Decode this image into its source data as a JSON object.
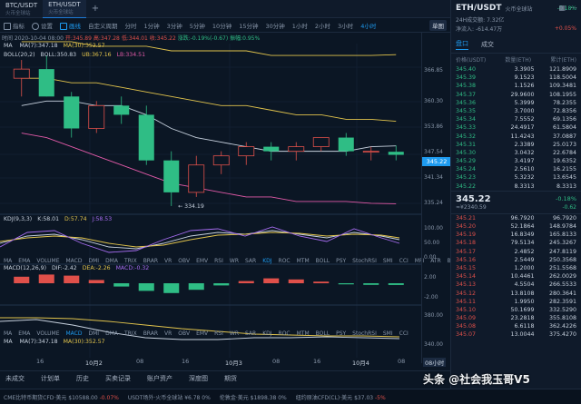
{
  "tabs": [
    {
      "pair": "BTC/USDT",
      "exchange": "火币全球站"
    },
    {
      "pair": "ETH/USDT",
      "exchange": "火币全球站"
    }
  ],
  "toolbar": {
    "items": [
      "指标",
      "设置",
      "画线",
      "自定义周期",
      "分时",
      "1分钟",
      "3分钟",
      "5分钟",
      "10分钟",
      "15分钟",
      "30分钟",
      "1小时",
      "2小时",
      "3小时",
      "4小时"
    ],
    "selected": "4小时",
    "layout": "单图"
  },
  "info_line": {
    "time": "时间 2020-10-04 08:00",
    "open": "开:345.89",
    "high": "高:347.28",
    "low": "低:344.01",
    "close": "收:345.22",
    "change": "涨跌:-0.19%(-0.67)",
    "amplitude": "振幅:0.95%"
  },
  "main_indicators": {
    "ma_label": "MA",
    "ma7": "MA(7):347.18",
    "ma30": "MA(30):352.57",
    "boll_label": "BOLL(20,2)",
    "boll": "BOLL:350.83",
    "ub": "UB:367.16",
    "lb": "LB:334.51",
    "low_marker": "334.19"
  },
  "price_axis": [
    "366.85",
    "360.30",
    "353.86",
    "347.54",
    "341.34",
    "335.24"
  ],
  "last_price": "345.22",
  "kdj": {
    "label": "KDJ(9,3,3)",
    "k": "K:58.01",
    "d": "D:57.74",
    "j": "J:58.53",
    "axis": [
      "100.00",
      "50.00",
      "0.00"
    ]
  },
  "ind_menu_a": [
    "MA",
    "EMA",
    "VOLUME",
    "MACD",
    "DMI",
    "DMA",
    "TRIX",
    "BRAR",
    "VR",
    "OBV",
    "EMV",
    "RSI",
    "WR",
    "SAR",
    "KDJ",
    "ROC",
    "MTM",
    "BOLL",
    "PSY",
    "StochRSI",
    "SMI",
    "CCI",
    "MFI",
    "ATR",
    "BBW"
  ],
  "ind_menu_a_active": "KDJ",
  "macd": {
    "label": "MACD(12,26,9)",
    "dif": "DIF:-2.42",
    "dea": "DEA:-2.26",
    "macd": "MACD:-0.32",
    "axis": [
      "2.00",
      "-2.00"
    ]
  },
  "ind_menu_b": [
    "MA",
    "EMA",
    "VOLUME",
    "MACD",
    "DMI",
    "DMA",
    "TRIX",
    "BRAR",
    "VR",
    "OBV",
    "EMV",
    "RSI",
    "WR",
    "SAR",
    "KDJ",
    "ROC",
    "MTM",
    "BOLL",
    "PSY",
    "StochRSI",
    "SMI",
    "CCI"
  ],
  "ind_menu_b_active": "MACD",
  "sub_ma": {
    "label": "MA",
    "ma7": "MA(7):347.18",
    "ma30": "MA(30):352.57",
    "axis": [
      "380.00",
      "340.00"
    ]
  },
  "time_axis": [
    "16",
    "10月2",
    "08",
    "16",
    "10月3",
    "08",
    "16",
    "10月4",
    "08"
  ],
  "hour_badge": "08小时",
  "bottom_tabs": [
    "未成交",
    "计划单",
    "历史",
    "买卖记录",
    "账户资产",
    "深度图",
    "期货"
  ],
  "ticker": [
    {
      "text": "CME比特币期货CFD·美元",
      "value": "$10588.00",
      "change": "-0.07%",
      "dir": "down"
    },
    {
      "text": "USDT场外·火币全球站",
      "value": "¥6.78",
      "change": "0%",
      "dir": "flat"
    },
    {
      "text": "伦敦金·美元",
      "value": "$1898.38",
      "change": "0%",
      "dir": "flat"
    },
    {
      "text": "纽约原油CFD(CL)·美元",
      "value": "$37.03",
      "change": "-5%",
      "dir": "down"
    }
  ],
  "panel": {
    "title": "ETH/USDT",
    "exchange": "火币全球站",
    "change_pct": "-0.18%",
    "sub_line": "24H成交额: 7.32亿",
    "net_in": "净流入: -614.47万",
    "stats": [
      "+0.03%",
      "+0.05%"
    ],
    "tabs": [
      "盘口",
      "成交"
    ],
    "active_tab": "盘口",
    "col_price": "价格(USDT)",
    "col_amount": "数量(ETH)",
    "col_total": "累计(ETH)",
    "asks": [
      [
        "345.40",
        "3.3905",
        "121.8909"
      ],
      [
        "345.39",
        "9.1523",
        "118.5004"
      ],
      [
        "345.38",
        "1.1526",
        "109.3481"
      ],
      [
        "345.37",
        "29.9600",
        "108.1955"
      ],
      [
        "345.36",
        "5.3999",
        "78.2355"
      ],
      [
        "345.35",
        "3.7000",
        "72.8356"
      ],
      [
        "345.34",
        "7.5552",
        "69.1356"
      ],
      [
        "345.33",
        "24.4917",
        "61.5804"
      ],
      [
        "345.32",
        "11.4243",
        "37.0887"
      ],
      [
        "345.31",
        "2.3389",
        "25.0173"
      ],
      [
        "345.30",
        "3.0432",
        "22.6784"
      ],
      [
        "345.29",
        "3.4197",
        "19.6352"
      ],
      [
        "345.24",
        "2.5610",
        "16.2155"
      ],
      [
        "345.23",
        "5.3232",
        "13.6545"
      ],
      [
        "345.22",
        "8.3313",
        "8.3313"
      ]
    ],
    "last": "345.22",
    "last_cny": "≈¥2340.59",
    "last_change": "-0.18%",
    "last_diff": "-0.62",
    "bids": [
      [
        "345.21",
        "96.7920",
        "96.7920"
      ],
      [
        "345.20",
        "52.1864",
        "148.9784"
      ],
      [
        "345.19",
        "16.8349",
        "165.8133"
      ],
      [
        "345.18",
        "79.5134",
        "245.3267"
      ],
      [
        "345.17",
        "2.4852",
        "247.8119"
      ],
      [
        "345.16",
        "2.5449",
        "250.3568"
      ],
      [
        "345.15",
        "1.2000",
        "251.5568"
      ],
      [
        "345.14",
        "10.4461",
        "262.0029"
      ],
      [
        "345.13",
        "4.5504",
        "266.5533"
      ],
      [
        "345.12",
        "13.8108",
        "280.3641"
      ],
      [
        "345.11",
        "1.9950",
        "282.3591"
      ],
      [
        "345.10",
        "50.1699",
        "332.5290"
      ],
      [
        "345.09",
        "23.2818",
        "355.8108"
      ],
      [
        "345.08",
        "6.6118",
        "362.4226"
      ],
      [
        "345.07",
        "13.0044",
        "375.4270"
      ]
    ]
  },
  "watermark": "头条 @社会我玉哥V5",
  "colors": {
    "up": "#e0504a",
    "down": "#2fbd85",
    "accent": "#1e9bf0",
    "bg": "#0b1624"
  },
  "chart_data": {
    "type": "candlestick",
    "x": [
      "10-01 20:00",
      "10-02 00:00",
      "10-02 04:00",
      "10-02 08:00",
      "10-02 12:00",
      "10-02 16:00",
      "10-02 20:00",
      "10-03 00:00",
      "10-03 04:00",
      "10-03 08:00",
      "10-03 12:00",
      "10-03 16:00",
      "10-03 20:00",
      "10-04 00:00",
      "10-04 04:00",
      "10-04 08:00"
    ],
    "ohlc": [
      [
        362,
        366,
        358,
        364
      ],
      [
        364,
        367,
        358,
        358
      ],
      [
        358,
        359,
        349,
        351
      ],
      [
        351,
        357,
        350,
        356
      ],
      [
        356,
        358,
        352,
        354
      ],
      [
        354,
        356,
        343,
        344
      ],
      [
        344,
        346,
        334,
        337
      ],
      [
        337,
        345,
        336,
        343
      ],
      [
        343,
        346,
        341,
        345
      ],
      [
        345,
        348,
        343,
        347
      ],
      [
        347,
        348,
        344,
        346
      ],
      [
        346,
        348,
        344,
        347
      ],
      [
        347,
        349,
        346,
        349
      ],
      [
        349,
        350,
        345,
        346
      ],
      [
        346,
        347,
        344,
        346
      ],
      [
        345.89,
        347.28,
        344.01,
        345.22
      ]
    ],
    "ma7": [
      356,
      357,
      357,
      356,
      356,
      354,
      351,
      349,
      348,
      347,
      346,
      346,
      346,
      346,
      347,
      347.18
    ],
    "ma30": [
      362,
      362,
      361,
      361,
      360,
      359,
      358,
      357,
      356,
      356,
      355,
      354,
      354,
      353,
      353,
      352.57
    ],
    "boll_ub": [
      370,
      370,
      370,
      369,
      369,
      369,
      368,
      368,
      368,
      368,
      367,
      367,
      367,
      367,
      367,
      367.16
    ],
    "boll_lb": [
      350,
      349,
      347,
      345,
      343,
      341,
      339,
      338,
      337,
      336,
      336,
      335,
      335,
      335,
      334.6,
      334.51
    ],
    "ylim": [
      333,
      368
    ]
  }
}
